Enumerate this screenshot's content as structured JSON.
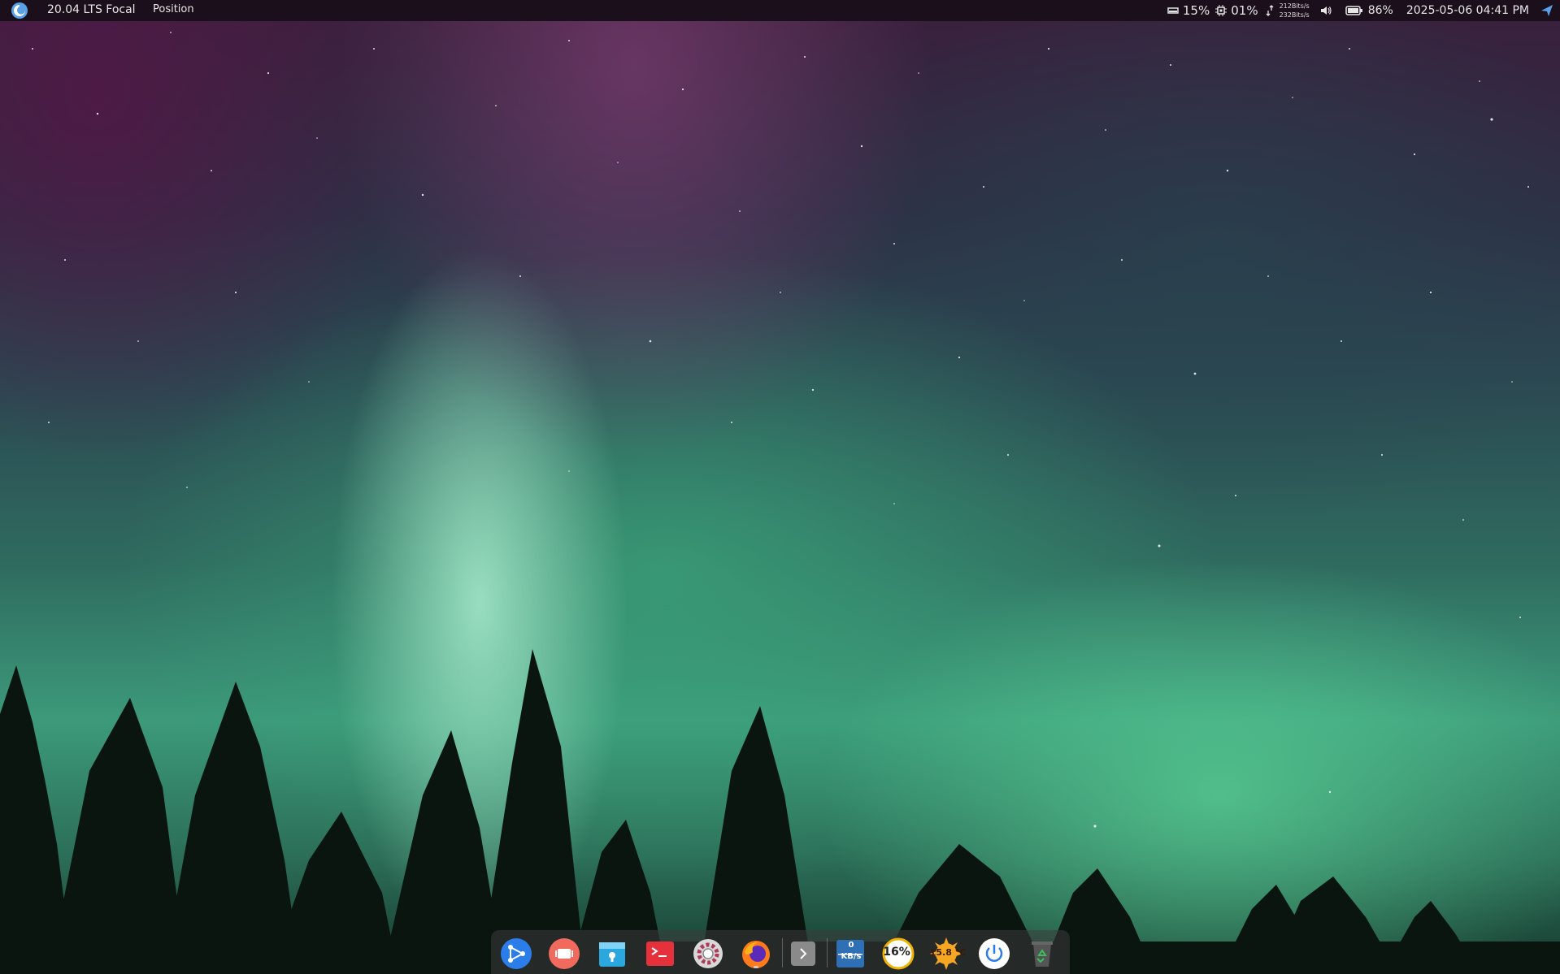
{
  "top_panel": {
    "distro_label": "20.04 LTS Focal",
    "menu_label": "Position",
    "disk_usage": "15%",
    "cpu_usage": "01%",
    "net_up": "212Bits/s",
    "net_down": "232Bits/s",
    "battery": "86%",
    "datetime": "2025-05-06 04:41 PM"
  },
  "dock": {
    "apps": [
      {
        "icon": "share-app-icon",
        "color": "#2b7de9"
      },
      {
        "icon": "screen-recorder-icon",
        "color": "#f06b5e"
      },
      {
        "icon": "file-manager-icon",
        "color": "#2aa7df"
      },
      {
        "icon": "terminal-icon",
        "color": "#e6303c"
      },
      {
        "icon": "settings-icon",
        "color": "#c8c8c8"
      },
      {
        "icon": "firefox-icon",
        "color": "#ff7a1a"
      },
      {
        "icon": "chevron-right-icon",
        "color": "#8a8a8a"
      }
    ],
    "net_widget": {
      "value": "0",
      "unit": "KB/s"
    },
    "cpu_widget_text": "16%",
    "weather_text": "15.8 °C",
    "power_icon": "power-icon",
    "trash_icon": "trash-icon"
  }
}
